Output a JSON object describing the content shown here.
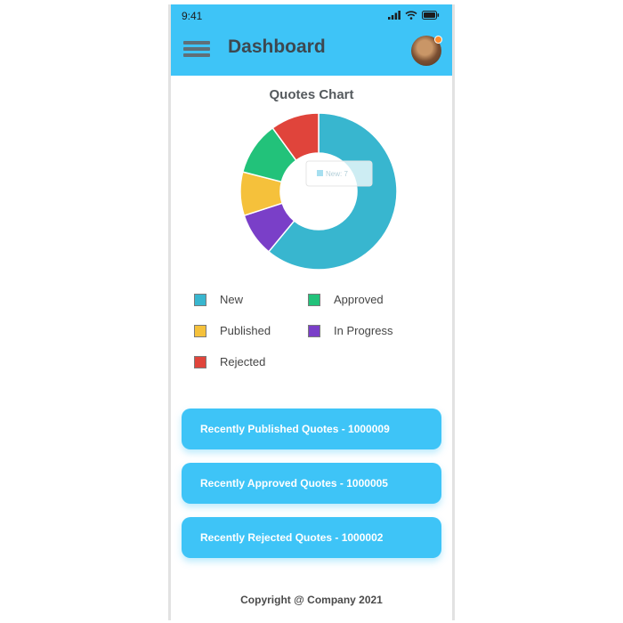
{
  "status_bar": {
    "time": "9:41"
  },
  "header": {
    "title": "Dashboard"
  },
  "chart_data": {
    "type": "pie",
    "title": "Quotes Chart",
    "categories": [
      "New",
      "In Progress",
      "Published",
      "Approved",
      "Rejected"
    ],
    "values": [
      61,
      9,
      9,
      11,
      10
    ],
    "colors": [
      "#38b6cf",
      "#7a3fc8",
      "#f5c13b",
      "#22c27a",
      "#e0443b"
    ],
    "tooltip_label": "New: 7",
    "legend": [
      {
        "label": "New",
        "color": "#38b6cf"
      },
      {
        "label": "Approved",
        "color": "#22c27a"
      },
      {
        "label": "Published",
        "color": "#f5c13b"
      },
      {
        "label": "In Progress",
        "color": "#7a3fc8"
      },
      {
        "label": "Rejected",
        "color": "#e0443b"
      }
    ]
  },
  "quote_buttons": [
    "Recently Published Quotes - 1000009",
    "Recently Approved Quotes - 1000005",
    "Recently Rejected Quotes - 1000002"
  ],
  "footer": {
    "text": "Copyright @ Company 2021"
  },
  "colors": {
    "accent": "#3ec4f7"
  }
}
